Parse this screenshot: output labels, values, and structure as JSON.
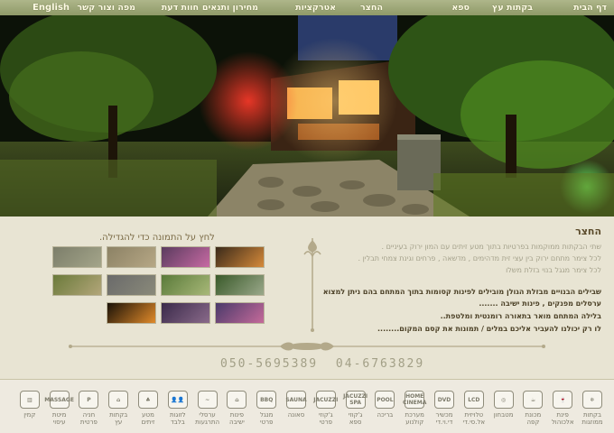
{
  "nav": {
    "items": [
      "דף הבית",
      "בקתות עץ",
      "ספא",
      "החצר",
      "אטרקציות",
      "מחירון ותנאים",
      "חוות דעת",
      "מפה וצור קשר",
      "English"
    ]
  },
  "content": {
    "title": "החצר",
    "light_lines": [
      "שתי הבקתות ממוקמות בפרטיות בתוך מטע זיתים עם המון ירוק בעיניים .",
      "לכל צימר מתחם ירוק בין עצי זית מדהימים , מדשאה , פרחים וגינת צמחי תבלין .",
      "לכל צימר מגגל בנוי בזלת משלו"
    ],
    "dark_lines": [
      "שבילים הבנויים מבזלת הגולן מובילים לפינות קסומות בתוך המתחם בהם ניתן למצוא",
      "ערסלים מפנקים , פינות ישיבה .......",
      "בלילה המתחם מואר בתאורה רומנטית ומלטפת..",
      "לו רק יכולנו להעביר אליכם במלים / תמונות את קסם המקום........"
    ]
  },
  "gallery": {
    "caption": "לחץ על התמונה כדי להגדילה."
  },
  "contact": {
    "phone_1": "050-5695389",
    "phone_2": "04-6763829"
  },
  "amenities": [
    {
      "icon": "snowflake-icon",
      "icon_text": "❄",
      "label": "בקתות\nממוזגות"
    },
    {
      "icon": "wine-glass-icon",
      "icon_text": "🍷",
      "label": "פינת\nאלכוהול"
    },
    {
      "icon": "coffee-cup-icon",
      "icon_text": "☕",
      "label": "מכונת\nקפה"
    },
    {
      "icon": "kitchen-icon",
      "icon_text": "◎",
      "label": "מטבחון"
    },
    {
      "icon": "lcd-icon",
      "icon_text": "LCD",
      "label": "טלויזית\nאל.סי.די"
    },
    {
      "icon": "dvd-icon",
      "icon_text": "DVD",
      "label": "מכשיר\nדי.וי.די"
    },
    {
      "icon": "home-cinema-icon",
      "icon_text": "HOME CINEMA",
      "label": "מערכת\nקולנוע"
    },
    {
      "icon": "pool-icon",
      "icon_text": "POOL",
      "label": "בריכה"
    },
    {
      "icon": "jacuzzi-spa-icon",
      "icon_text": "JACUZZI SPA",
      "label": "ג'קוזי\nספא"
    },
    {
      "icon": "jacuzzi-icon",
      "icon_text": "JACUZZI",
      "label": "ג'קוזי\nפרטי"
    },
    {
      "icon": "sauna-icon",
      "icon_text": "SAUNA",
      "label": "סאונה"
    },
    {
      "icon": "bbq-icon",
      "icon_text": "BBQ",
      "label": "מנגל\nפרטי"
    },
    {
      "icon": "seating-icon",
      "icon_text": "⌂",
      "label": "פינות\nישיבה"
    },
    {
      "icon": "hammock-icon",
      "icon_text": "~",
      "label": "ערסלי\nהתרגעות"
    },
    {
      "icon": "couples-icon",
      "icon_text": "👤👤",
      "label": "לזוגות\nבלבד"
    },
    {
      "icon": "olive-grove-icon",
      "icon_text": "♣",
      "label": "מטע\nזיתים"
    },
    {
      "icon": "wood-cabin-icon",
      "icon_text": "⌂",
      "label": "בקתות\nעץ"
    },
    {
      "icon": "parking-icon",
      "icon_text": "P",
      "label": "חניה\nפרטית"
    },
    {
      "icon": "massage-icon",
      "icon_text": "MASSAGE",
      "label": "מיטת\nעיסוי"
    },
    {
      "icon": "fireplace-icon",
      "icon_text": "▥",
      "label": "קמין"
    }
  ],
  "colors": {
    "nav_bg": "#8f9a68",
    "page_bg": "#e8e4d3",
    "text_dark": "#4a3f25",
    "text_light": "#a3a08a"
  }
}
